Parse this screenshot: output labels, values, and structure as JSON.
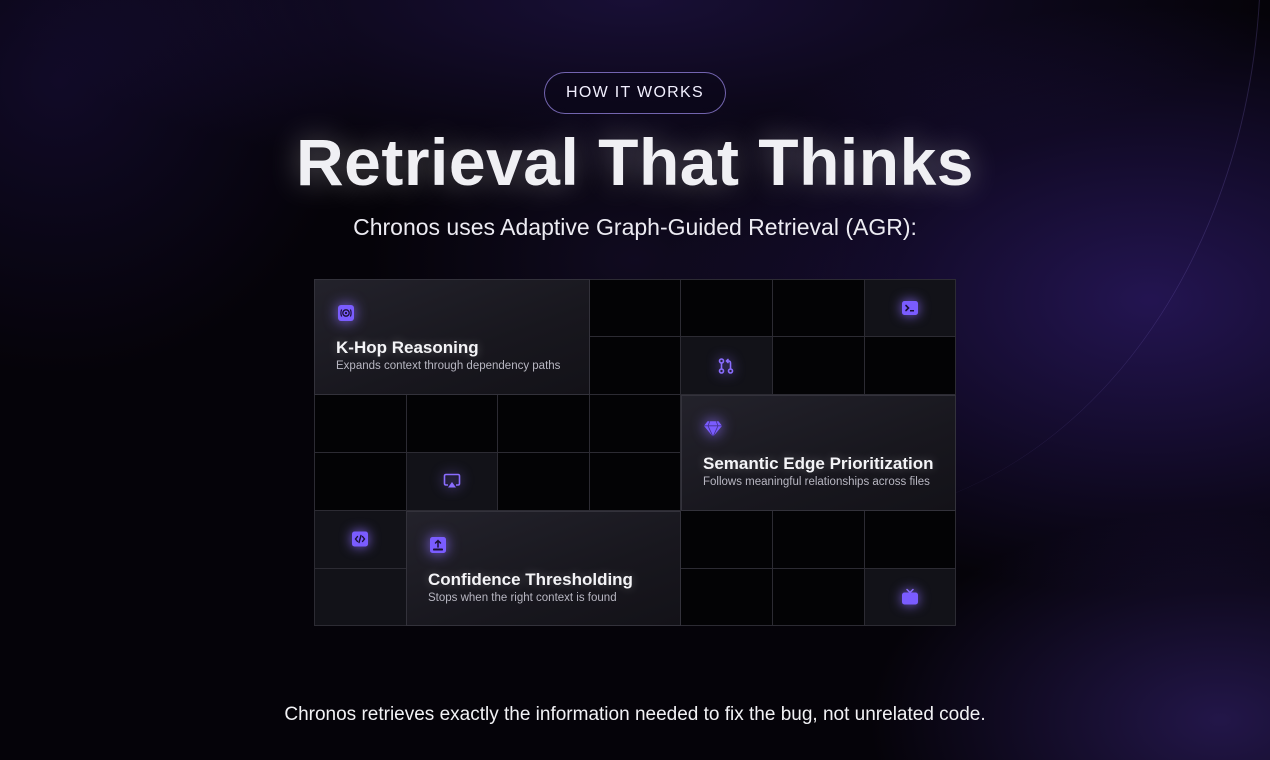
{
  "header": {
    "badge": "HOW IT WORKS",
    "title": "Retrieval That Thinks",
    "subtitle": "Chronos uses Adaptive Graph-Guided Retrieval (AGR):"
  },
  "features": [
    {
      "title": "K-Hop Reasoning",
      "description": "Expands context through dependency paths",
      "icon": "radio-icon"
    },
    {
      "title": "Semantic Edge Prioritization",
      "description": "Follows meaningful relationships across files",
      "icon": "gem-icon"
    },
    {
      "title": "Confidence Thresholding",
      "description": "Stops when the right context is found",
      "icon": "upload-box-icon"
    }
  ],
  "grid_icons": [
    "terminal-icon",
    "git-pull-request-icon",
    "airplay-icon",
    "code-icon",
    "tv-icon"
  ],
  "footer": {
    "text": "Chronos retrieves exactly the information needed to fix the bug, not unrelated code."
  },
  "colors": {
    "accent": "#7a5cff",
    "background": "#050309",
    "card": "#1c1b22"
  }
}
